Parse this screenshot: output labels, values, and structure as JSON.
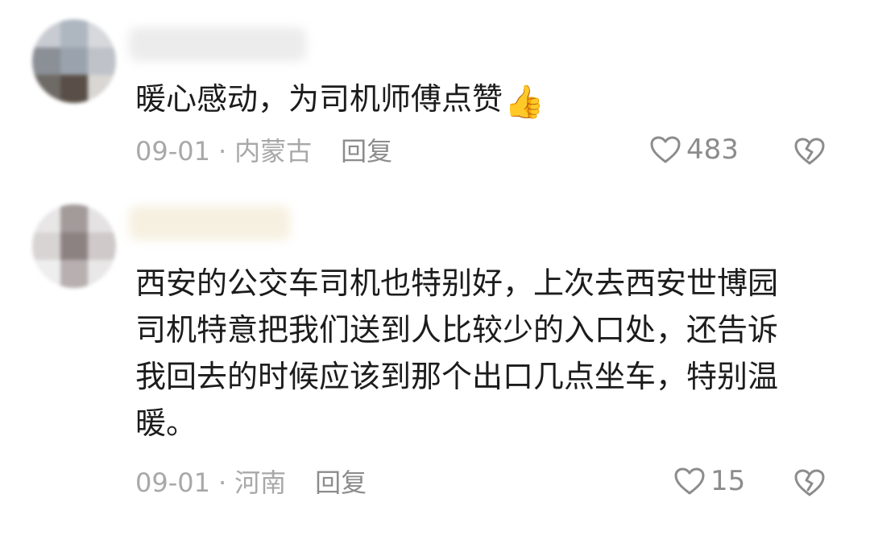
{
  "comments": [
    {
      "text": "暖心感动，为司机师傅点赞",
      "emoji": "👍",
      "date": "09-01",
      "separator": "·",
      "location": "内蒙古",
      "reply_label": "回复",
      "like_count": "483",
      "avatar_colors": [
        "#c8ccd2",
        "#aeb6c0",
        "#d6d8dc",
        "#8b8f96",
        "#9aa3ad",
        "#bfc3c9",
        "#6e6a66",
        "#5a4f48",
        "#d9d6d3"
      ]
    },
    {
      "text": "西安的公交车司机也特别好，上次去西安世博园\n司机特意把我们送到人比较少的入口处，还告诉\n我回去的时候应该到那个出口几点坐车，特别温\n暖。",
      "date": "09-01",
      "separator": "·",
      "location": "河南",
      "reply_label": "回复",
      "like_count": "15",
      "avatar_colors": [
        "#e8e6e6",
        "#a39a9a",
        "#e4e2e2",
        "#d8d4d4",
        "#8c8282",
        "#cfc9c9",
        "#efeeee",
        "#b8b0b0",
        "#e9e7e7"
      ]
    }
  ],
  "colors": {
    "meta_text": "#a8a8a8",
    "action_icon": "#8c8c8c",
    "body_text": "#1c1c1c"
  },
  "icons": {
    "like": "heart-outline-icon",
    "dislike": "broken-heart-icon"
  }
}
